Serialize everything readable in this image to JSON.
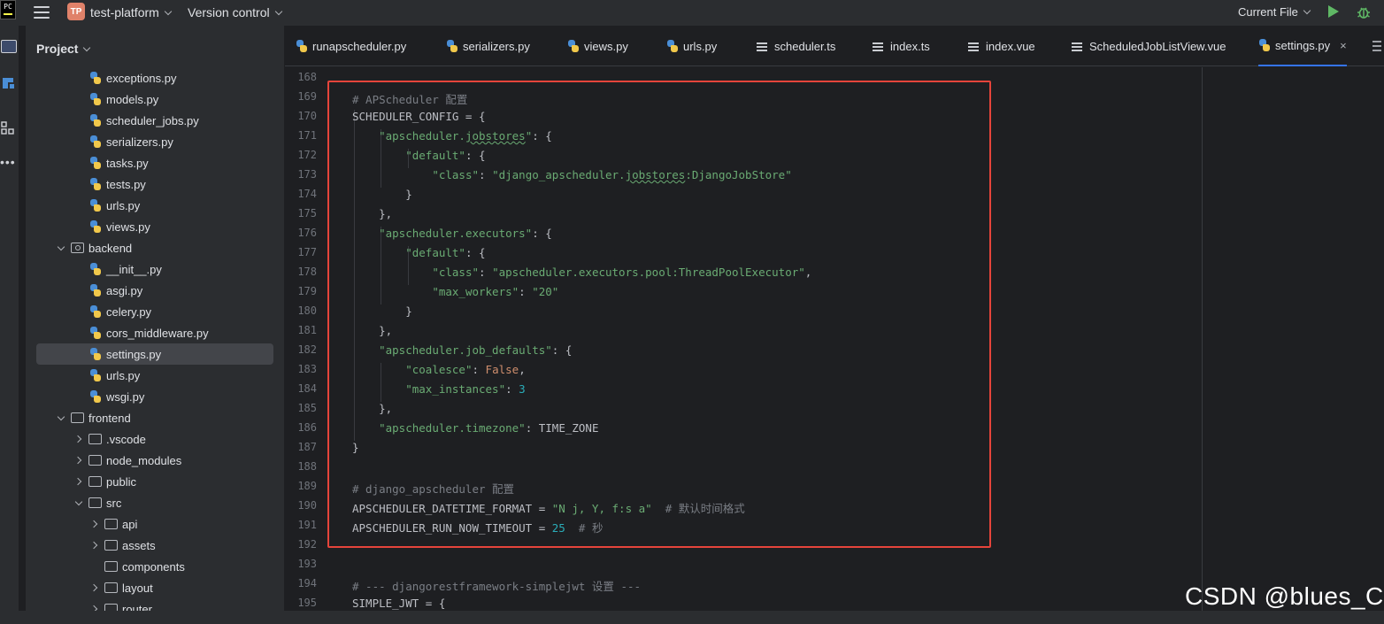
{
  "titlebar": {
    "app_logo": "PC",
    "project_badge": "TP",
    "project_name": "test-platform",
    "version_control": "Version control",
    "run_config": "Current File",
    "run_icon": "run-icon",
    "debug_icon": "debug-bug-icon"
  },
  "project_panel": {
    "title": "Project",
    "items": [
      {
        "label": "exceptions.py",
        "type": "py",
        "depth": 3
      },
      {
        "label": "models.py",
        "type": "py",
        "depth": 3
      },
      {
        "label": "scheduler_jobs.py",
        "type": "py",
        "depth": 3
      },
      {
        "label": "serializers.py",
        "type": "py",
        "depth": 3
      },
      {
        "label": "tasks.py",
        "type": "py",
        "depth": 3
      },
      {
        "label": "tests.py",
        "type": "py",
        "depth": 3
      },
      {
        "label": "urls.py",
        "type": "py",
        "depth": 3
      },
      {
        "label": "views.py",
        "type": "py",
        "depth": 3
      },
      {
        "label": "backend",
        "type": "pkg",
        "depth": 1,
        "expanded": true
      },
      {
        "label": "__init__.py",
        "type": "py",
        "depth": 3
      },
      {
        "label": "asgi.py",
        "type": "py",
        "depth": 3
      },
      {
        "label": "celery.py",
        "type": "py",
        "depth": 3
      },
      {
        "label": "cors_middleware.py",
        "type": "py",
        "depth": 3
      },
      {
        "label": "settings.py",
        "type": "py",
        "depth": 3,
        "selected": true
      },
      {
        "label": "urls.py",
        "type": "py",
        "depth": 3
      },
      {
        "label": "wsgi.py",
        "type": "py",
        "depth": 3
      },
      {
        "label": "frontend",
        "type": "folder",
        "depth": 1,
        "expanded": true
      },
      {
        "label": ".vscode",
        "type": "folder",
        "depth": 2,
        "expanded": false
      },
      {
        "label": "node_modules",
        "type": "folder",
        "depth": 2,
        "expanded": false
      },
      {
        "label": "public",
        "type": "folder",
        "depth": 2,
        "expanded": false
      },
      {
        "label": "src",
        "type": "folder",
        "depth": 2,
        "expanded": true
      },
      {
        "label": "api",
        "type": "folder",
        "depth": 3,
        "expanded": false
      },
      {
        "label": "assets",
        "type": "folder",
        "depth": 3,
        "expanded": false
      },
      {
        "label": "components",
        "type": "folder",
        "depth": 3,
        "leaf": true
      },
      {
        "label": "layout",
        "type": "folder",
        "depth": 3,
        "expanded": false
      },
      {
        "label": "router",
        "type": "folder",
        "depth": 3,
        "expanded": false
      }
    ]
  },
  "tabs": [
    {
      "label": "runapscheduler.py",
      "icon": "py"
    },
    {
      "label": "serializers.py",
      "icon": "py"
    },
    {
      "label": "views.py",
      "icon": "py"
    },
    {
      "label": "urls.py",
      "icon": "py"
    },
    {
      "label": "scheduler.ts",
      "icon": "lines"
    },
    {
      "label": "index.ts",
      "icon": "lines"
    },
    {
      "label": "index.vue",
      "icon": "lines"
    },
    {
      "label": "ScheduledJobListView.vue",
      "icon": "lines"
    },
    {
      "label": "settings.py",
      "icon": "py",
      "active": true,
      "close": "×"
    }
  ],
  "code": [
    {
      "n": "168",
      "parts": []
    },
    {
      "n": "169",
      "parts": [
        [
          "c",
          "# APScheduler 配置"
        ]
      ]
    },
    {
      "n": "170",
      "parts": [
        [
          "p",
          "SCHEDULER_CONFIG = {"
        ]
      ]
    },
    {
      "n": "171",
      "parts": [
        [
          "p",
          "    "
        ],
        [
          "s",
          "\"apscheduler."
        ],
        [
          "su",
          "jobstores"
        ],
        [
          "s",
          "\""
        ],
        [
          "p",
          ": {"
        ]
      ]
    },
    {
      "n": "172",
      "parts": [
        [
          "p",
          "        "
        ],
        [
          "s",
          "\"default\""
        ],
        [
          "p",
          ": {"
        ]
      ]
    },
    {
      "n": "173",
      "parts": [
        [
          "p",
          "            "
        ],
        [
          "s",
          "\"class\""
        ],
        [
          "p",
          ": "
        ],
        [
          "s",
          "\"django_apscheduler."
        ],
        [
          "su",
          "jobstores"
        ],
        [
          "s",
          ":DjangoJobStore\""
        ]
      ]
    },
    {
      "n": "174",
      "parts": [
        [
          "p",
          "        }"
        ]
      ]
    },
    {
      "n": "175",
      "parts": [
        [
          "p",
          "    },"
        ]
      ]
    },
    {
      "n": "176",
      "parts": [
        [
          "p",
          "    "
        ],
        [
          "s",
          "\"apscheduler.executors\""
        ],
        [
          "p",
          ": {"
        ]
      ]
    },
    {
      "n": "177",
      "parts": [
        [
          "p",
          "        "
        ],
        [
          "s",
          "\"default\""
        ],
        [
          "p",
          ": {"
        ]
      ]
    },
    {
      "n": "178",
      "parts": [
        [
          "p",
          "            "
        ],
        [
          "s",
          "\"class\""
        ],
        [
          "p",
          ": "
        ],
        [
          "s",
          "\"apscheduler.executors.pool:ThreadPoolExecutor\""
        ],
        [
          "p",
          ","
        ]
      ]
    },
    {
      "n": "179",
      "parts": [
        [
          "p",
          "            "
        ],
        [
          "s",
          "\"max_workers\""
        ],
        [
          "p",
          ": "
        ],
        [
          "s",
          "\"20\""
        ]
      ]
    },
    {
      "n": "180",
      "parts": [
        [
          "p",
          "        }"
        ]
      ]
    },
    {
      "n": "181",
      "parts": [
        [
          "p",
          "    },"
        ]
      ]
    },
    {
      "n": "182",
      "parts": [
        [
          "p",
          "    "
        ],
        [
          "s",
          "\"apscheduler.job_defaults\""
        ],
        [
          "p",
          ": {"
        ]
      ]
    },
    {
      "n": "183",
      "parts": [
        [
          "p",
          "        "
        ],
        [
          "s",
          "\"coalesce\""
        ],
        [
          "p",
          ": "
        ],
        [
          "k",
          "False"
        ],
        [
          "p",
          ","
        ]
      ]
    },
    {
      "n": "184",
      "parts": [
        [
          "p",
          "        "
        ],
        [
          "s",
          "\"max_instances\""
        ],
        [
          "p",
          ": "
        ],
        [
          "n",
          "3"
        ]
      ]
    },
    {
      "n": "185",
      "parts": [
        [
          "p",
          "    },"
        ]
      ]
    },
    {
      "n": "186",
      "parts": [
        [
          "p",
          "    "
        ],
        [
          "s",
          "\"apscheduler.timezone\""
        ],
        [
          "p",
          ": TIME_ZONE"
        ]
      ]
    },
    {
      "n": "187",
      "parts": [
        [
          "p",
          "}"
        ]
      ]
    },
    {
      "n": "188",
      "parts": []
    },
    {
      "n": "189",
      "parts": [
        [
          "c",
          "# django_apscheduler 配置"
        ]
      ]
    },
    {
      "n": "190",
      "parts": [
        [
          "p",
          "APSCHEDULER_DATETIME_FORMAT = "
        ],
        [
          "s",
          "\"N j, Y, f:s a\""
        ],
        [
          "p",
          "  "
        ],
        [
          "c",
          "# 默认时间格式"
        ]
      ]
    },
    {
      "n": "191",
      "parts": [
        [
          "p",
          "APSCHEDULER_RUN_NOW_TIMEOUT = "
        ],
        [
          "n",
          "25"
        ],
        [
          "p",
          "  "
        ],
        [
          "c",
          "# 秒"
        ]
      ]
    },
    {
      "n": "192",
      "parts": []
    },
    {
      "n": "193",
      "parts": []
    },
    {
      "n": "194",
      "parts": [
        [
          "c",
          "# --- djangorestframework-simplejwt 设置 ---"
        ]
      ]
    },
    {
      "n": "195",
      "parts": [
        [
          "p",
          "SIMPLE_JWT = {"
        ]
      ]
    }
  ],
  "watermark": "CSDN @blues_C",
  "colors": {
    "highlight_box": "#e5443b",
    "string": "#6aab73",
    "comment": "#7a7e85",
    "keyword": "#cf8e6d",
    "number": "#2aacb8",
    "accent": "#3574f0"
  }
}
